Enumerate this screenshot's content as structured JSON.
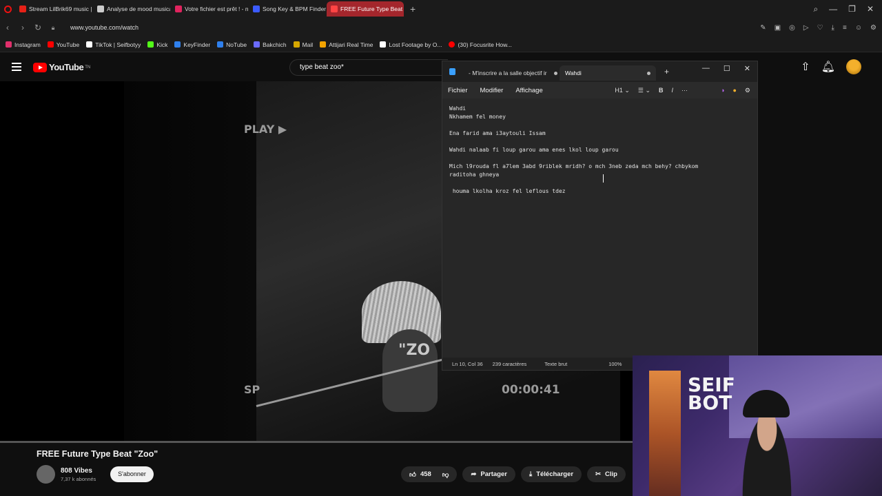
{
  "browser": {
    "tabs": [
      {
        "label": "Stream LilBrik69 music | Li",
        "color": "#e62117",
        "active": false
      },
      {
        "label": "Analyse de mood musical",
        "color": "#cccccc",
        "active": false
      },
      {
        "label": "Votre fichier est prêt ! - nc",
        "color": "#e0245e",
        "active": false
      },
      {
        "label": "Song Key & BPM Finder |",
        "color": "#3b5bff",
        "active": false
      },
      {
        "label": "FREE Future Type Beat",
        "color": "#e62117",
        "active": true
      }
    ],
    "url": "www.youtube.com/watch",
    "bookmarks": [
      {
        "label": "Instagram",
        "color": "#e1306c"
      },
      {
        "label": "YouTube",
        "color": "#ff0000"
      },
      {
        "label": "TikTok | Seifbotyy",
        "color": "#ffffff"
      },
      {
        "label": "Kick",
        "color": "#53fc18"
      },
      {
        "label": "KeyFinder",
        "color": "#2f80ed"
      },
      {
        "label": "NoTube",
        "color": "#2f80ed"
      },
      {
        "label": "Bakchich",
        "color": "#6b6bff"
      },
      {
        "label": "Mail",
        "color": "#d6a700"
      },
      {
        "label": "Attijari Real Time",
        "color": "#f2a300"
      },
      {
        "label": "Lost Footage by O...",
        "color": "#ffffff"
      },
      {
        "label": "(30) Focusrite How...",
        "color": "#ff0000"
      }
    ]
  },
  "youtube": {
    "logo_text": "YouTube",
    "logo_tm": "TN",
    "search_query": "type beat zoo*",
    "video": {
      "overlay_play": "PLAY ▶",
      "overlay_title": "\"ZO",
      "overlay_sp": "SP",
      "overlay_timecode": "00:00:41"
    },
    "title": "FREE Future Type Beat \"Zoo\"",
    "channel_name": "808 Vibes",
    "channel_subs": "7,37 k abonnés",
    "subscribe_label": "S'abonner",
    "likes": "458",
    "share_label": "Partager",
    "download_label": "Télécharger",
    "clip_label": "Clip"
  },
  "notepad": {
    "tabs": [
      {
        "label": "- M'inscrire a la salle objectif ir",
        "active": false
      },
      {
        "label": "Wahdi",
        "active": true
      }
    ],
    "menu": [
      "Fichier",
      "Modifier",
      "Affichage"
    ],
    "heading_label": "H1",
    "lines": [
      "Wahdi",
      "Nkhamem fel money",
      "",
      "Ena farid ama i3aytouli Issam",
      "",
      "Wahdi nalaab fi loup garou ama enes lkol loup garou",
      "",
      "Mich l9rouda fl a7lem 3abd 9riblek mridh? o mch 3neb zeda mch behy? chbykom",
      "raditoha ghneya",
      "",
      " houma lkolha kroz fel leflous tdez"
    ],
    "status": {
      "position": "Ln 10, Col 36",
      "chars": "239 caractères",
      "format": "Texte brut",
      "zoom": "100%"
    }
  },
  "webcam": {
    "sign_text": "SEIF BOT"
  }
}
